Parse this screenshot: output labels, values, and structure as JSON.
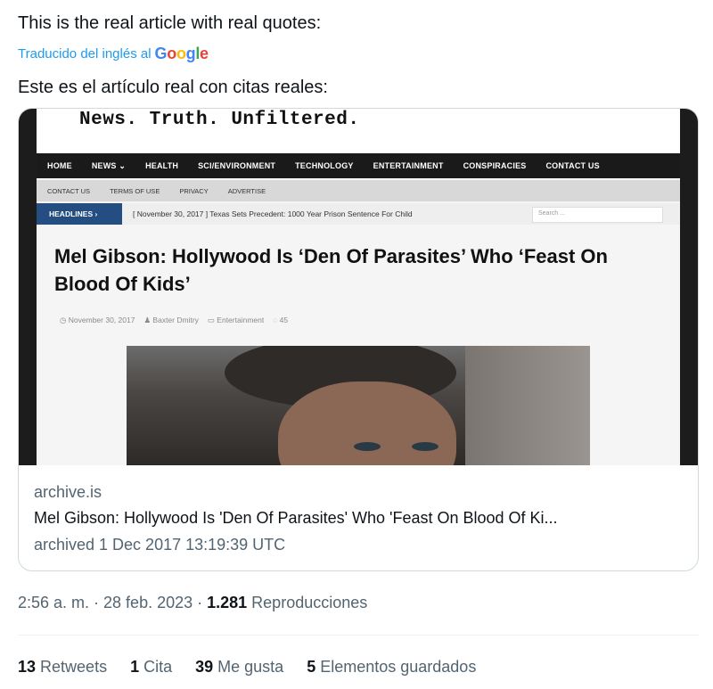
{
  "tweet": {
    "text_en": "This is the real article with real quotes:",
    "translated_label": "Traducido del inglés al",
    "translator_brand": {
      "G": "G",
      "o1": "o",
      "o2": "o",
      "g": "g",
      "l": "l",
      "e": "e"
    },
    "text_es": "Este es el artículo real con citas reales:"
  },
  "card": {
    "site": {
      "tagline": "News. Truth. Unfiltered.",
      "main_nav": [
        "HOME",
        "NEWS ⌄",
        "HEALTH",
        "SCI/ENVIRONMENT",
        "TECHNOLOGY",
        "ENTERTAINMENT",
        "CONSPIRACIES",
        "CONTACT US"
      ],
      "sub_nav": [
        "CONTACT US",
        "TERMS OF USE",
        "PRIVACY",
        "ADVERTISE"
      ],
      "headlines_label": "HEADLINES ›",
      "ticker": "[ November 30, 2017 ]  Texas Sets Precedent: 1000 Year Prison Sentence For Child",
      "search_placeholder": "Search ...",
      "article_title": "Mel Gibson: Hollywood Is ‘Den Of Parasites’ Who ‘Feast On Blood Of Kids’",
      "meta": {
        "date": "◷ November 30, 2017",
        "author": "♟ Baxter Dmitry",
        "category": "▭ Entertainment",
        "comments": "◌ 45"
      }
    },
    "domain": "archive.is",
    "title": "Mel Gibson: Hollywood Is 'Den Of Parasites' Who 'Feast On Blood Of Ki...",
    "archived": "archived 1 Dec 2017 13:19:39 UTC"
  },
  "footer": {
    "time": "2:56 a. m. · 28 feb. 2023 · ",
    "views_count": "1.281",
    "views_label": " Reproducciones",
    "retweets_count": "13",
    "retweets_label": " Retweets",
    "quotes_count": "1",
    "quotes_label": " Cita",
    "likes_count": "39",
    "likes_label": " Me gusta",
    "bookmarks_count": "5",
    "bookmarks_label": " Elementos guardados"
  },
  "colors": {
    "link_blue": "#1d9bf0",
    "secondary_text": "#536471",
    "headline_badge": "#244d82"
  }
}
